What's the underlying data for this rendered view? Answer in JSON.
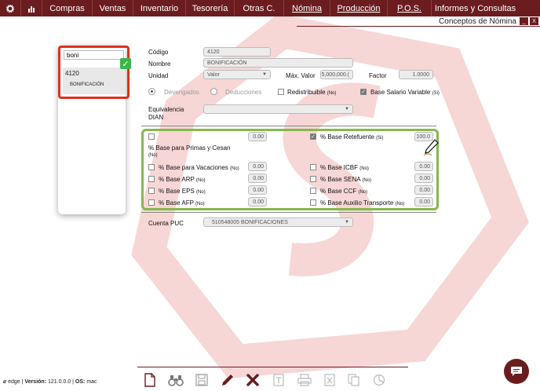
{
  "nav": {
    "items": [
      "Compras",
      "Ventas",
      "Inventario",
      "Tesorería",
      "Otras C.",
      "Nómina",
      "Producción",
      "P.O.S.",
      "Informes y Consultas"
    ]
  },
  "header": {
    "title": "Conceptos de Nómina",
    "minimize": "_",
    "close": "X"
  },
  "search": {
    "value": "boni",
    "result_code": "4120",
    "result_name": "BONIFICACIÓN"
  },
  "form": {
    "codigo_label": "Código",
    "codigo_value": "4120",
    "nombre_label": "Nombre",
    "nombre_value": "BONIFICACIÓN",
    "unidad_label": "Unidad",
    "unidad_value": "Valor",
    "maxvalor_label": "Máx. Valor",
    "maxvalor_value": "5,000,000.(",
    "factor_label": "Factor",
    "factor_value": "1.0000",
    "devengados_label": "Devengados",
    "deducciones_label": "Deducciones",
    "redistribuible_label": "Redistribuible",
    "redistribuible_state": "(No)",
    "salario_variable_label": "Base Salario Variable",
    "salario_variable_state": "(Si)",
    "equivalencia_label": "Equivalencia",
    "dian_label": "DIAN",
    "cuenta_label": "Cuenta PUC",
    "cuenta_value": "510548005 BONIFICACIONES"
  },
  "bases": {
    "first_value": "0.00",
    "retefuente_label": "% Base Retefuente",
    "retefuente_state": "(Si)",
    "retefuente_value": "100.0",
    "primas_label": "% Base para Primas y Cesan",
    "primas_state": "(No)",
    "vacaciones_label": "% Base para Vacaciones",
    "vacaciones_state": "(No)",
    "vacaciones_value": "0.00",
    "icbf_label": "% Base ICBF",
    "icbf_state": "(No)",
    "icbf_value": "0.00",
    "arp_label": "% Base ARP",
    "arp_state": "(No)",
    "arp_value": "0.00",
    "sena_label": "% Base SENA",
    "sena_state": "(No)",
    "sena_value": "0.00",
    "eps_label": "% Base EPS",
    "eps_state": "(No)",
    "eps_value": "0.00",
    "ccf_label": "% Base CCF",
    "ccf_state": "(No)",
    "ccf_value": "0.00",
    "afp_label": "% Base AFP",
    "afp_state": "(No)",
    "afp_value": "0.00",
    "auxilio_label": "% Base Auxilio Transporte",
    "auxilio_state": "(No)",
    "auxilio_value": "0.00"
  },
  "footer": {
    "brand": "edge",
    "version_label": "Versión:",
    "version": "121.0.0.0",
    "os_label": "OS:",
    "os": "mac"
  },
  "colors": {
    "brand": "#6b1c1f",
    "highlight_red": "#e0311f",
    "highlight_green": "#86b84b",
    "check_green": "#3cb54a"
  }
}
